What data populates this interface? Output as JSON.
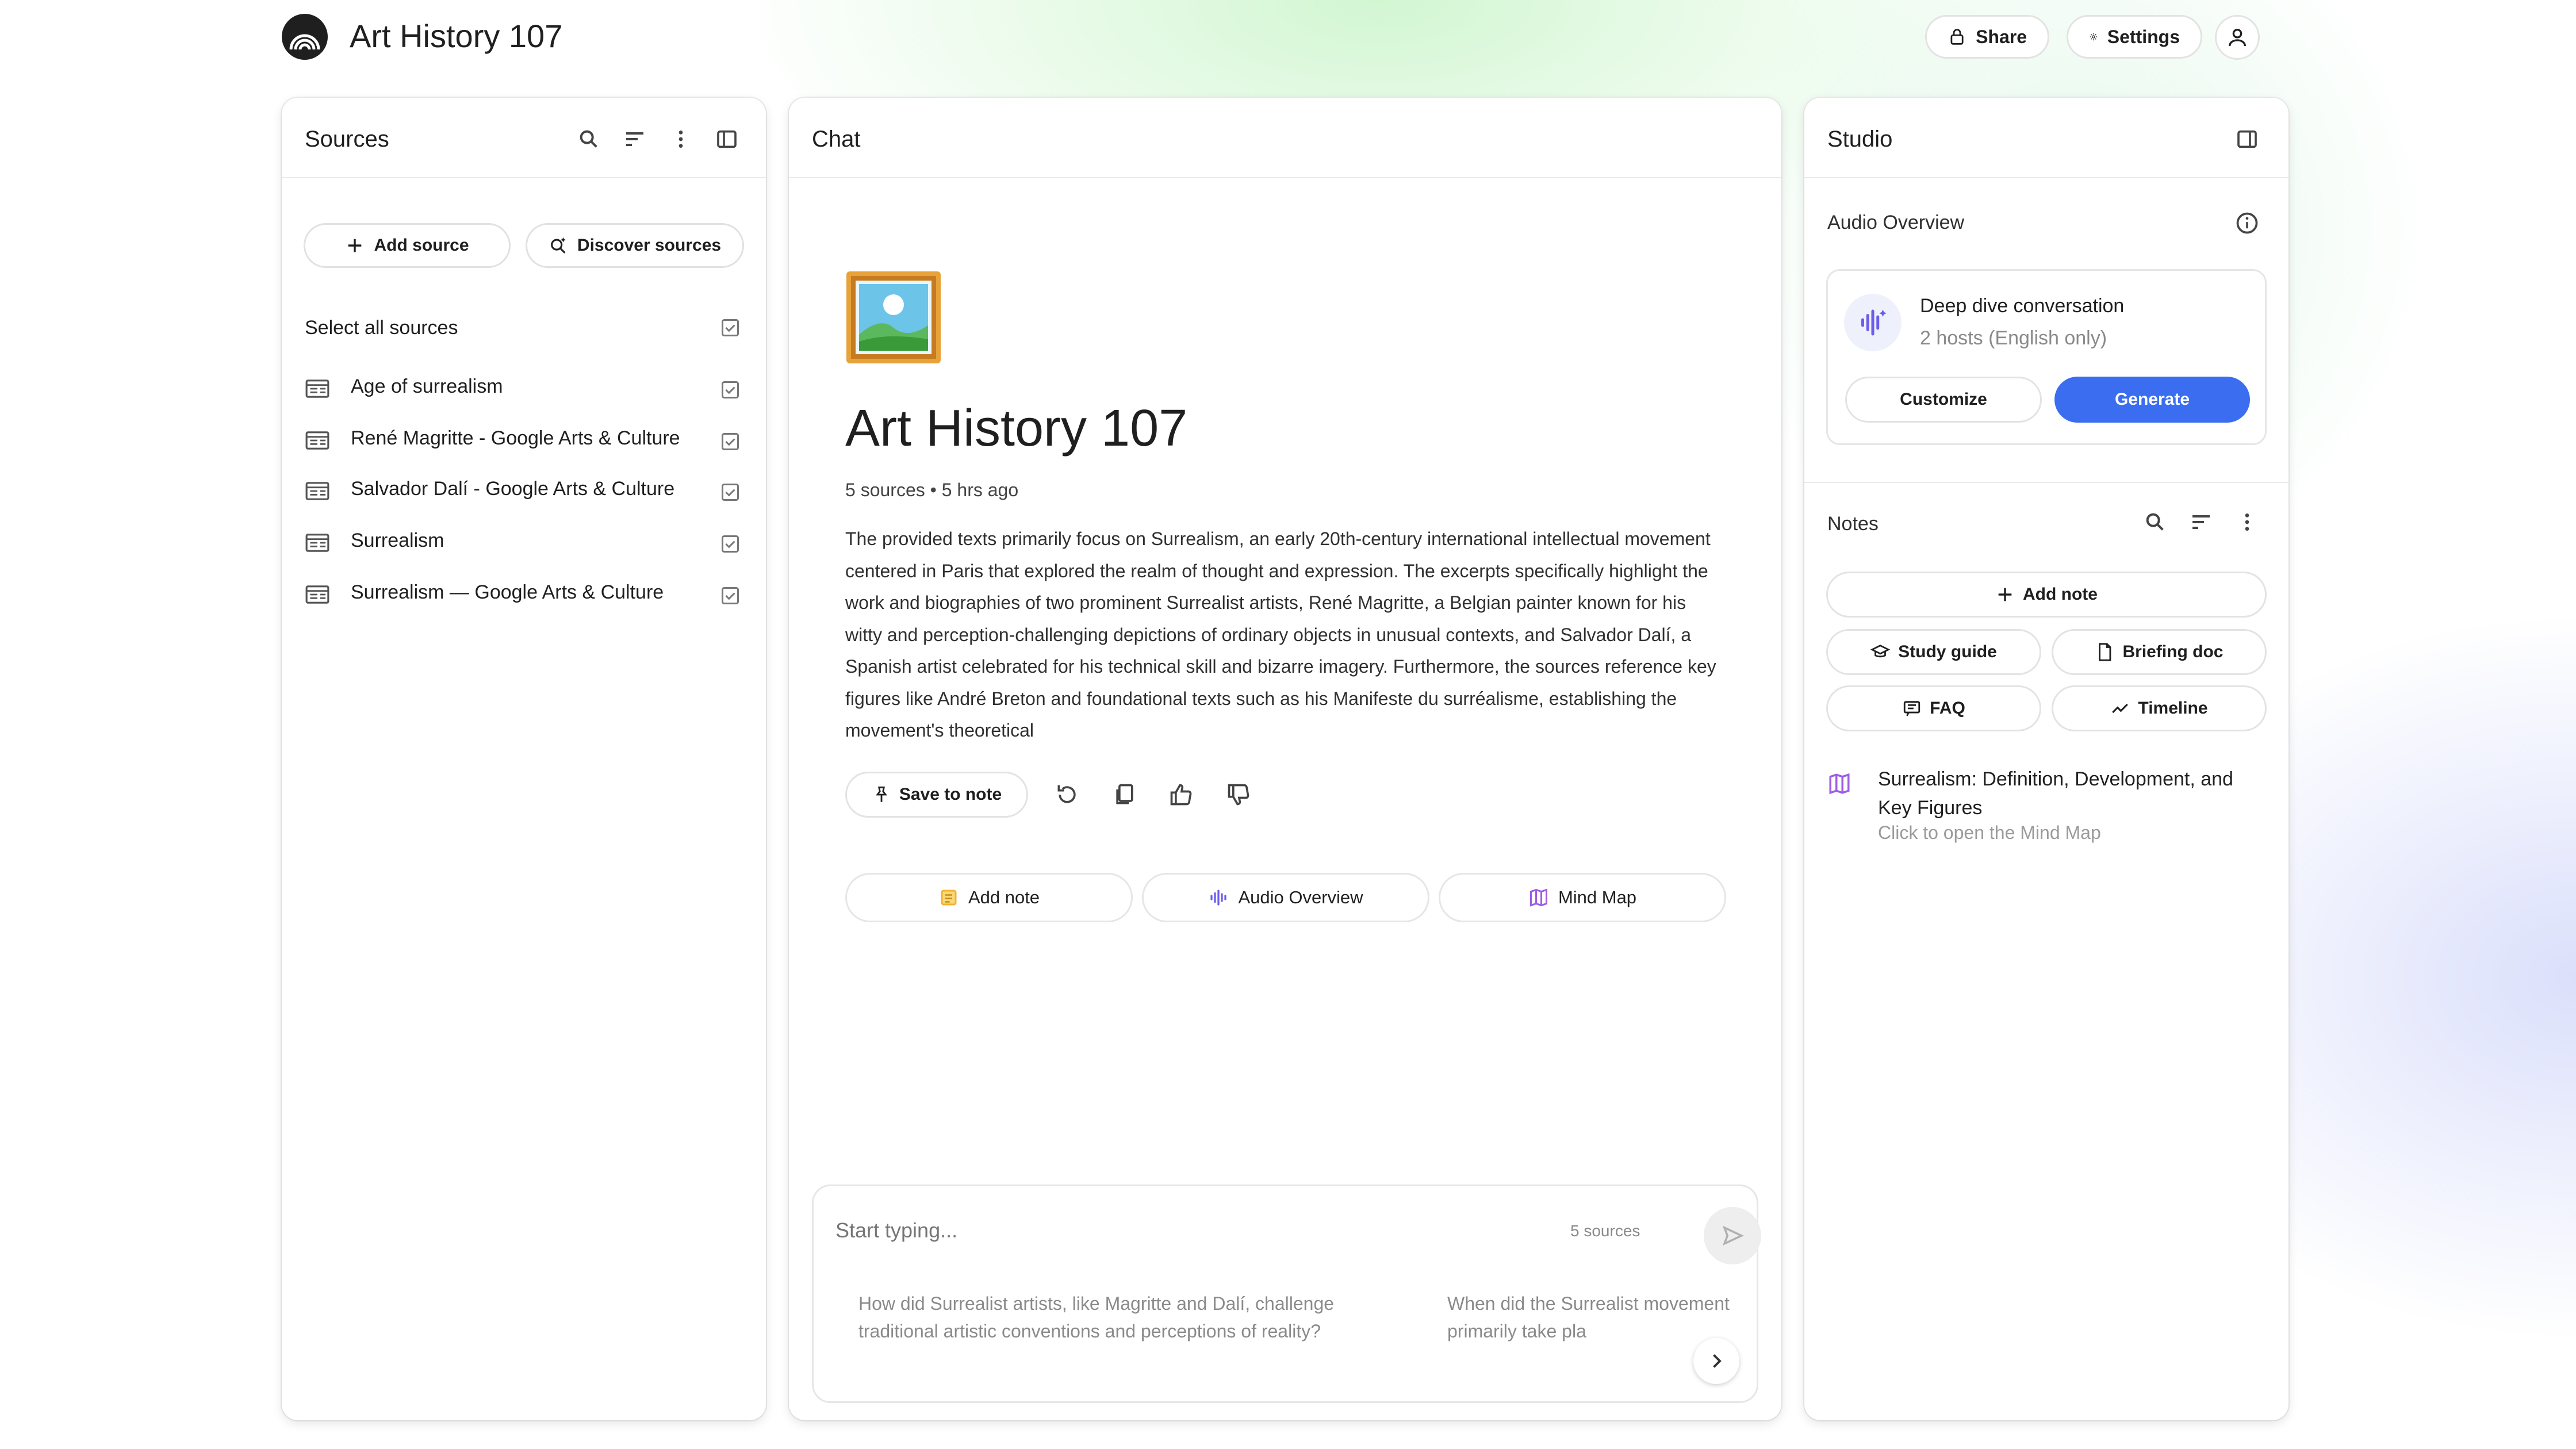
{
  "app": {
    "title": "Art History 107"
  },
  "topbar": {
    "share_label": "Share",
    "settings_label": "Settings"
  },
  "sources": {
    "title": "Sources",
    "add_source_label": "Add source",
    "discover_label": "Discover sources",
    "select_all_label": "Select all sources",
    "items": [
      {
        "label": "Age of surrealism"
      },
      {
        "label": "René Magritte - Google Arts & Culture"
      },
      {
        "label": "Salvador Dalí - Google Arts & Culture"
      },
      {
        "label": "Surrealism"
      },
      {
        "label": "Surrealism — Google Arts & Culture"
      }
    ]
  },
  "chat": {
    "title": "Chat",
    "notebook_title": "Art History 107",
    "meta": "5 sources • 5 hrs ago",
    "summary": "The provided texts primarily focus on Surrealism, an early 20th-century international intellectual movement centered in Paris that explored the realm of thought and expression. The excerpts specifically highlight the work and biographies of two prominent Surrealist artists, René Magritte, a Belgian painter known for his witty and perception-challenging depictions of ordinary objects in unusual contexts, and Salvador Dalí, a Spanish artist celebrated for his technical skill and bizarre imagery. Furthermore, the sources reference key figures like André Breton and foundational texts such as his Manifeste du surréalisme, establishing the movement's theoretical",
    "save_to_note_label": "Save to note",
    "add_note_label": "Add note",
    "audio_overview_label": "Audio Overview",
    "mind_map_label": "Mind Map",
    "composer": {
      "placeholder": "Start typing...",
      "source_count": "5 sources",
      "suggestions": [
        "How did Surrealist artists, like Magritte and Dalí, challenge traditional artistic conventions and perceptions of reality?",
        "When did the Surrealist movement primarily take pla"
      ]
    }
  },
  "studio": {
    "title": "Studio",
    "audio_overview": {
      "title": "Audio Overview",
      "card_title": "Deep dive conversation",
      "card_subtitle": "2 hosts (English only)",
      "customize_label": "Customize",
      "generate_label": "Generate"
    },
    "notes": {
      "title": "Notes",
      "add_note_label": "Add note",
      "study_guide_label": "Study guide",
      "briefing_doc_label": "Briefing doc",
      "faq_label": "FAQ",
      "timeline_label": "Timeline",
      "mind_map_title": "Surrealism: Definition, Development, and Key Figures",
      "mind_map_subtitle": "Click to open the Mind Map"
    }
  },
  "colors": {
    "accent": "#3a6df0",
    "mindmap": "#9b5de5",
    "audio": "#6b5cf0",
    "note": "#f2b233"
  }
}
